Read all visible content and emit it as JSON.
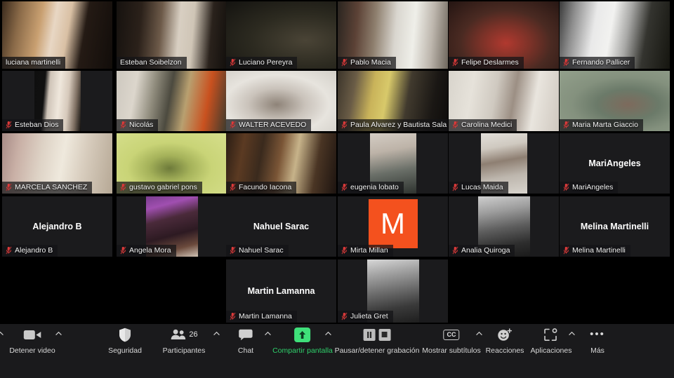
{
  "app": {
    "name": "Zoom",
    "view": "gallery-view",
    "accent_speaking": "#d9f35b",
    "accent_share": "#3fe07a",
    "avatar_color": "#f4511e"
  },
  "gallery": {
    "rows": [
      {
        "row": 1,
        "tiles": [
          {
            "name": "luciana martinelli",
            "speaking": true,
            "muted": false,
            "video": true,
            "kind": "video",
            "cam": "warm-indoor-door"
          },
          {
            "name": "Esteban Soibelzon",
            "speaking": false,
            "muted": false,
            "video": true,
            "kind": "video",
            "cam": "dark-wall-art"
          },
          {
            "name": "Luciano Pereyra",
            "speaking": false,
            "muted": true,
            "video": true,
            "kind": "video",
            "cam": "olive-dim"
          },
          {
            "name": "Pablo Macia",
            "speaking": false,
            "muted": true,
            "video": true,
            "kind": "video",
            "cam": "brick-shelf"
          },
          {
            "name": "Felipe Deslarmes",
            "speaking": false,
            "muted": true,
            "video": true,
            "kind": "video",
            "cam": "red-shirt-warm"
          },
          {
            "name": "Fernando Pallicer",
            "speaking": false,
            "muted": true,
            "video": true,
            "kind": "video",
            "cam": "bright-window"
          }
        ]
      },
      {
        "row": 2,
        "tiles": [
          {
            "name": "Esteban Dios",
            "speaking": false,
            "muted": true,
            "video": true,
            "kind": "video-narrow",
            "cam": "pale-lamp"
          },
          {
            "name": "Nicolás",
            "speaking": false,
            "muted": true,
            "video": true,
            "kind": "video",
            "cam": "shelf-plant"
          },
          {
            "name": "WALTER ACEVEDO",
            "speaking": false,
            "muted": true,
            "video": true,
            "kind": "video",
            "cam": "white-wall-glasses"
          },
          {
            "name": "Paula Alvarez y Bautista Sala",
            "speaking": false,
            "muted": true,
            "video": true,
            "kind": "video",
            "cam": "dark-yellow"
          },
          {
            "name": "Carolina Medici",
            "speaking": false,
            "muted": true,
            "video": true,
            "kind": "video",
            "cam": "curtain-room"
          },
          {
            "name": "Maria Marta Giaccio",
            "speaking": false,
            "muted": true,
            "video": true,
            "kind": "video",
            "cam": "green-backdrop"
          }
        ]
      },
      {
        "row": 3,
        "tiles": [
          {
            "name": "MARCELA SANCHEZ",
            "speaking": false,
            "muted": true,
            "video": true,
            "kind": "video",
            "cam": "beige-sofa"
          },
          {
            "name": "gustavo gabriel pons",
            "speaking": false,
            "muted": true,
            "video": true,
            "kind": "video",
            "cam": "yellow-wall"
          },
          {
            "name": "Facundo Iacona",
            "speaking": false,
            "muted": true,
            "video": true,
            "kind": "video",
            "cam": "wood-panel"
          },
          {
            "name": "eugenia lobato",
            "speaking": false,
            "muted": true,
            "video": true,
            "kind": "video-narrow",
            "cam": "pale-portrait"
          },
          {
            "name": "Lucas Maida",
            "speaking": false,
            "muted": true,
            "video": true,
            "kind": "video-narrow",
            "cam": "grey-sweater"
          },
          {
            "name": "MariAngeles",
            "speaking": false,
            "muted": true,
            "video": false,
            "kind": "name-only",
            "cam": ""
          }
        ]
      },
      {
        "row": 4,
        "tiles": [
          {
            "name": "Alejandro B",
            "speaking": false,
            "muted": true,
            "video": false,
            "kind": "name-only",
            "cam": ""
          },
          {
            "name": "Angela Mora",
            "speaking": false,
            "muted": true,
            "video": false,
            "kind": "avatar-photo",
            "cam": "purple-portrait"
          },
          {
            "name": "Nahuel Sarac",
            "speaking": false,
            "muted": true,
            "video": false,
            "kind": "name-only",
            "cam": ""
          },
          {
            "name": "Mirta Millan",
            "speaking": false,
            "muted": true,
            "video": false,
            "kind": "avatar-letter",
            "cam": "",
            "initial": "M"
          },
          {
            "name": "Analia Quiroga",
            "speaking": false,
            "muted": true,
            "video": false,
            "kind": "avatar-photo",
            "cam": "bw-portrait"
          },
          {
            "name": "Melina Martinelli",
            "speaking": false,
            "muted": true,
            "video": false,
            "kind": "name-only",
            "cam": ""
          }
        ]
      },
      {
        "row": 5,
        "tiles": [
          {
            "name": "Martin Lamanna",
            "speaking": false,
            "muted": true,
            "video": false,
            "kind": "name-only",
            "cam": "",
            "col": 3
          },
          {
            "name": "Julieta Gret",
            "speaking": false,
            "muted": true,
            "video": false,
            "kind": "avatar-photo",
            "cam": "bw-portrait-2",
            "col": 4
          }
        ]
      }
    ]
  },
  "toolbar": {
    "items": [
      {
        "id": "video",
        "label": "Detener video",
        "icon": "camera-icon",
        "has_chevron": true,
        "green": false
      },
      {
        "id": "security",
        "label": "Seguridad",
        "icon": "shield-icon",
        "has_chevron": false,
        "green": false
      },
      {
        "id": "participants",
        "label": "Participantes",
        "icon": "people-icon",
        "has_chevron": true,
        "green": false,
        "count": "26"
      },
      {
        "id": "chat",
        "label": "Chat",
        "icon": "chat-bubble-icon",
        "has_chevron": true,
        "green": false
      },
      {
        "id": "share",
        "label": "Compartir pantalla",
        "icon": "share-up-arrow-icon",
        "has_chevron": true,
        "green": true
      },
      {
        "id": "recording",
        "label": "Pausar/detener grabación",
        "icon": "pause-stop-icon",
        "has_chevron": false,
        "green": false
      },
      {
        "id": "captions",
        "label": "Mostrar subtítulos",
        "icon": "cc-icon",
        "has_chevron": true,
        "green": false
      },
      {
        "id": "reactions",
        "label": "Reacciones",
        "icon": "smiley-plus-icon",
        "has_chevron": false,
        "green": false
      },
      {
        "id": "apps",
        "label": "Aplicaciones",
        "icon": "apps-bracket-icon",
        "has_chevron": true,
        "green": false
      },
      {
        "id": "more",
        "label": "Más",
        "icon": "ellipsis-icon",
        "has_chevron": false,
        "green": false
      }
    ]
  }
}
